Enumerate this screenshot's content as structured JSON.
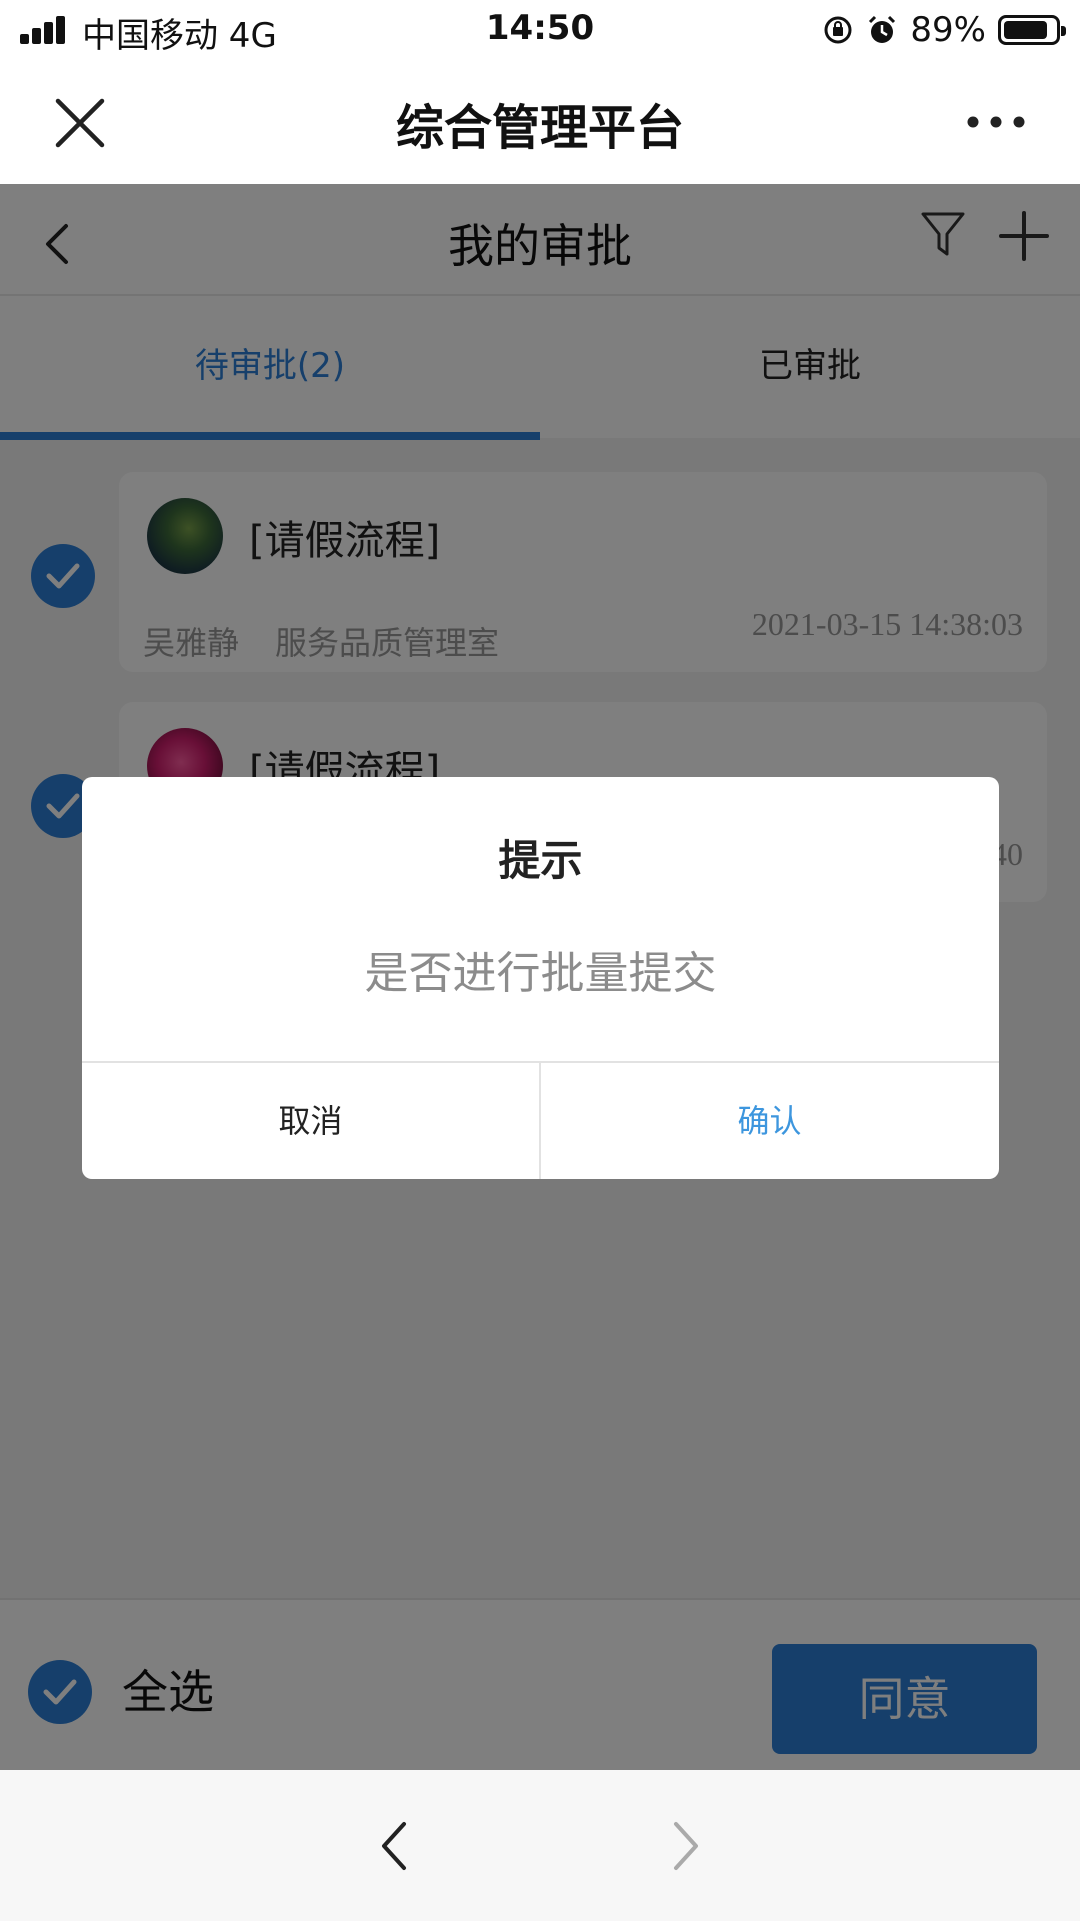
{
  "status_bar": {
    "carrier": "中国移动   4G",
    "time": "14:50",
    "battery_percent": "89%",
    "icons": [
      "signal-icon",
      "rotation-lock-icon",
      "alarm-icon",
      "battery-icon"
    ]
  },
  "app_header": {
    "title": "综合管理平台",
    "icons": [
      "close-icon",
      "more-icon"
    ]
  },
  "nav": {
    "title": "我的审批",
    "icons": [
      "back-icon",
      "filter-icon",
      "add-icon"
    ]
  },
  "tabs": [
    {
      "label": "待审批(2)",
      "active": true
    },
    {
      "label": "已审批",
      "active": false
    }
  ],
  "approvals": [
    {
      "title": "[请假流程]",
      "applicant": "吴雅静",
      "department": "服务品质管理室",
      "time": "2021-03-15 14:38:03",
      "checked": true
    },
    {
      "title": "[请假流程]",
      "time_fragment": "40",
      "checked": true
    }
  ],
  "bottom_bar": {
    "select_all_label": "全选",
    "agree_label": "同意"
  },
  "dialog": {
    "title": "提示",
    "message": "是否进行批量提交",
    "cancel_label": "取消",
    "confirm_label": "确认"
  },
  "colors": {
    "accent": "#2c7fd6",
    "confirm_text": "#3d96de",
    "overlay": "rgba(0,0,0,0.5)"
  }
}
